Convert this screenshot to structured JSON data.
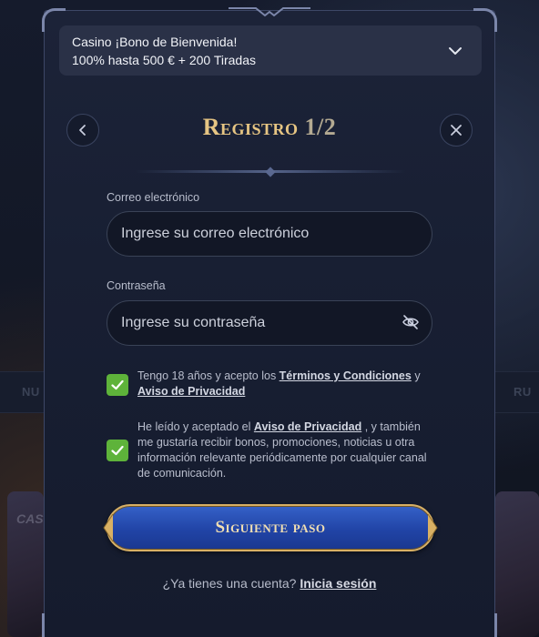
{
  "background": {
    "strip_left": "NU",
    "strip_right": "RU",
    "card_label": "CAS"
  },
  "bonus": {
    "line1": "Casino ¡Bono de Bienvenida!",
    "line2": "100% hasta 500 € + 200 Tiradas"
  },
  "header": {
    "title": "Registro",
    "step": "1/2"
  },
  "form": {
    "email": {
      "label": "Correo electrónico",
      "placeholder": "Ingrese su correo electrónico",
      "value": ""
    },
    "password": {
      "label": "Contraseña",
      "placeholder": "Ingrese su contraseña",
      "value": ""
    },
    "consent_terms": {
      "checked": true,
      "text_before": "Tengo 18 años y acepto los ",
      "link1": "Términos y Condiciones",
      "text_between": " y ",
      "link2": "Aviso de Privacidad"
    },
    "consent_marketing": {
      "checked": true,
      "text_before": "He leído y aceptado el ",
      "link": "Aviso de Privacidad",
      "text_after": " , y también me gustaría recibir bonos, promociones, noticias u otra información relevante periódicamente por cualquier canal de comunicación."
    }
  },
  "cta": {
    "label": "Siguiente paso"
  },
  "footer": {
    "question": "¿Ya tienes una cuenta? ",
    "login_link": "Inicia sesión"
  },
  "icons": {
    "back": "chevron-left-icon",
    "close": "close-icon",
    "dropdown": "chevron-down-icon",
    "password_toggle": "eye-off-icon",
    "checkbox": "checkmark-icon"
  },
  "colors": {
    "accent_gold": "#e6c583",
    "checkbox_green": "#5eb33a",
    "cta_blue": "#2144a6",
    "modal_bg": "#1a2135"
  }
}
